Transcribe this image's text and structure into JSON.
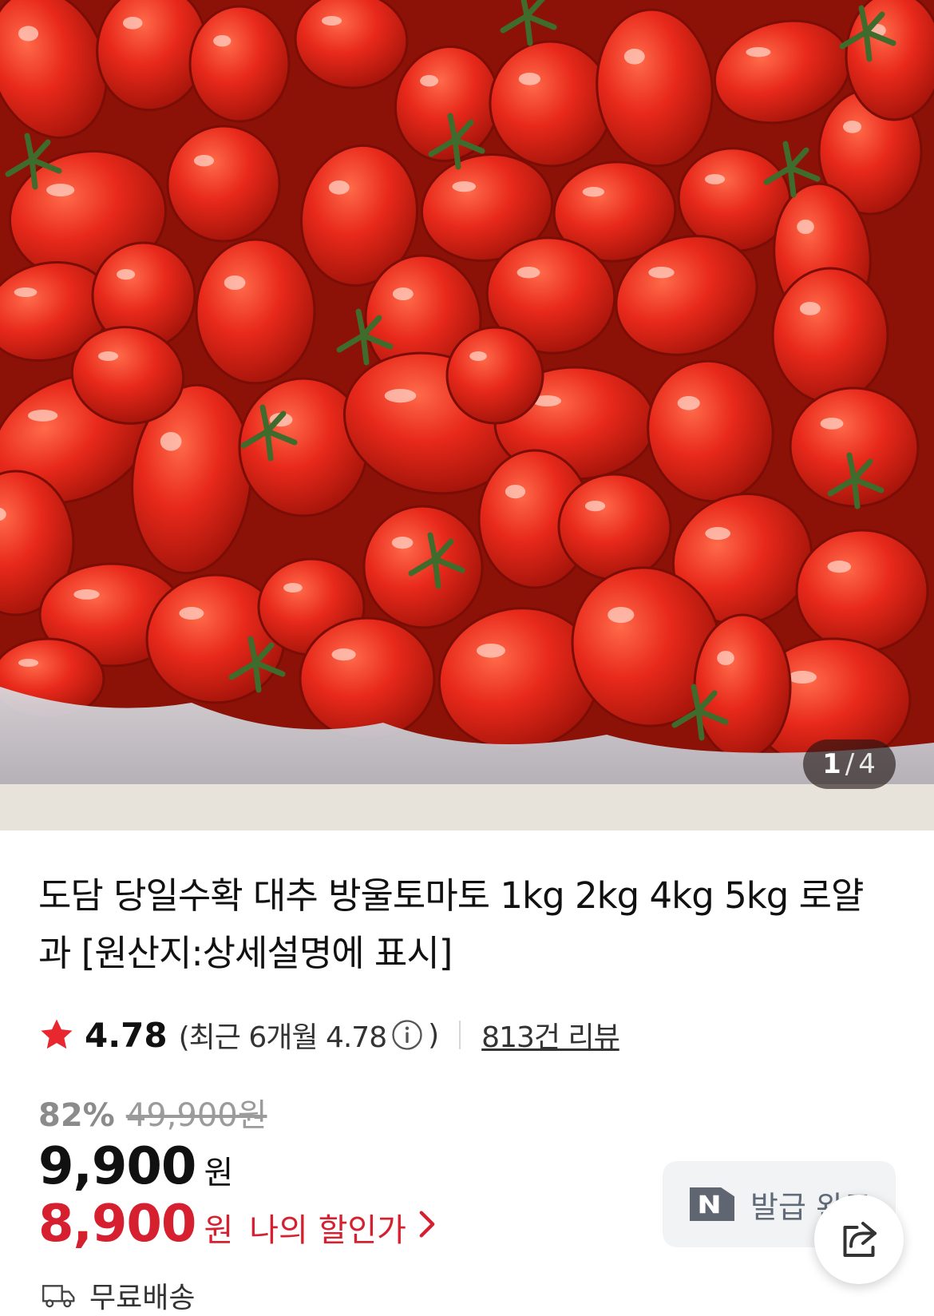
{
  "gallery": {
    "current": "1",
    "separator": "/",
    "total": "4",
    "image_icon": "tomato-photo"
  },
  "product": {
    "title": "도담 당일수확 대추 방울토마토 1kg 2kg 4kg 5kg 로얄과 [원산지:상세설명에 표시]"
  },
  "rating": {
    "star_icon": "star-icon",
    "score": "4.78",
    "recent_open": "(최근 6개월 4.78",
    "recent_close": ")",
    "info_icon": "info-icon",
    "review_link": "813건 리뷰"
  },
  "pricing": {
    "discount_rate": "82%",
    "original_price": "49,900원",
    "price": "9,900",
    "price_unit": "원",
    "my_price": "8,900",
    "my_price_unit": "원",
    "my_price_label": "나의 할인가",
    "accent_color": "#d6202f"
  },
  "coupon": {
    "icon": "naver-pay-icon",
    "label": "발급 완료"
  },
  "share": {
    "icon": "share-icon"
  },
  "delivery": {
    "icon": "truck-icon",
    "label": "무료배송"
  }
}
